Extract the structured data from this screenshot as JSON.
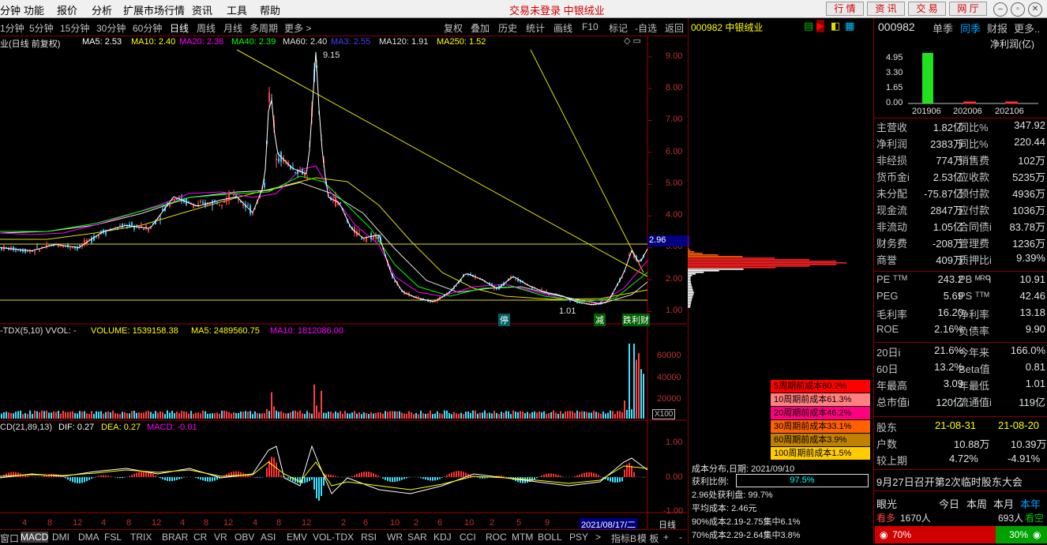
{
  "menu": {
    "items": [
      "分钟",
      "功能",
      "报价",
      "分析",
      "扩展市场行情",
      "资讯",
      "工具",
      "帮助"
    ],
    "center_msg": "交易未登录  中银绒业",
    "trade_buttons": [
      "行 情",
      "资 讯",
      "交 易",
      "网 厅"
    ]
  },
  "toolbar": {
    "periods": [
      "1分钟",
      "5分钟",
      "15分钟",
      "30分钟",
      "60分钟",
      "日线",
      "周线",
      "月线",
      "多周期",
      "更多 >"
    ],
    "active_period": "日线",
    "buttons": [
      "复权",
      "叠加",
      "历史",
      "统计",
      "画线",
      "F10",
      "标记",
      "-自选",
      "返回"
    ]
  },
  "main_chart": {
    "title": "业(日线 前复权)",
    "ma_labels": [
      {
        "text": "MA5: 2.53",
        "color": "#ffffff"
      },
      {
        "text": "MA10: 2.40",
        "color": "#ffff00"
      },
      {
        "text": "MA20: 2.36",
        "color": "#ff00ff"
      },
      {
        "text": "MA40: 2.39",
        "color": "#00ff00"
      },
      {
        "text": "MA60: 2.40",
        "color": "#e0e0e0"
      },
      {
        "text": "MA3: 2.55",
        "color": "#4040ff"
      },
      {
        "text": "MA120: 1.91",
        "color": "#e0e0e0"
      },
      {
        "text": "MA250: 1.52",
        "color": "#ffff00"
      }
    ],
    "y_ticks": [
      "9.00",
      "8.00",
      "7.00",
      "6.00",
      "5.00",
      "4.00",
      "3.00",
      "2.00",
      "1.00"
    ],
    "high_label": "9.15",
    "low_label": "1.01",
    "current_price_tag": "2.96",
    "markers": [
      "停",
      "减",
      "跌",
      "利",
      "财"
    ]
  },
  "volume_chart": {
    "title": "-TDX(5,10)  VVOL: -",
    "volume_label": "VOLUME: 1539158.38",
    "ma5_label": "MA5: 2489560.75",
    "ma10_label": "MA10: 1812086.00",
    "y_ticks": [
      "60000",
      "40000",
      "20000"
    ],
    "unit": "X100"
  },
  "macd_chart": {
    "title": "CD(21,89,13)",
    "dif": "DIF: 0.27",
    "dea": "DEA: 0.27",
    "macd": "MACD: -0.01",
    "y_ticks": [
      "1.00",
      "0.00",
      "-1.00"
    ]
  },
  "x_axis": {
    "labels": [
      "4",
      "8",
      "12",
      "4",
      "8",
      "12",
      "4",
      "8",
      "12",
      "4",
      "8",
      "12",
      "2",
      "6",
      "10",
      "2",
      "6",
      "10",
      "2",
      "5",
      "9"
    ],
    "cursor_date": "2021/08/17/二",
    "end_label": "日线"
  },
  "bottom_tabs": [
    "窗口",
    "MACD",
    "DMI",
    "DMA",
    "FSL",
    "TRIX",
    "BRAR",
    "CR",
    "VR",
    "OBV",
    "ASI",
    "EMV",
    "VOL-TDX",
    "RSI",
    "WR",
    "SAR",
    "KDJ",
    "CCI",
    "ROC",
    "MTM",
    "BOLL",
    "PSY",
    ">",
    "指标B",
    "模 板",
    "+",
    "-"
  ],
  "cost_panel": {
    "header": "000982 中银绒业",
    "legend": [
      {
        "text": "5周期前成本80.2%",
        "color": "#ff0000"
      },
      {
        "text": "10周期前成本61.3%",
        "color": "#ff8080"
      },
      {
        "text": "20周期前成本46.2%",
        "color": "#ff0080"
      },
      {
        "text": "30周期前成本33.1%",
        "color": "#ff6000"
      },
      {
        "text": "60周期前成本3.9%",
        "color": "#c08000"
      },
      {
        "text": "100周期前成本1.5%",
        "color": "#ffcc00"
      }
    ],
    "date_line": "成本分布,日期:  2021/09/10",
    "profit_ratio_label": "获利比例:",
    "profit_ratio_value": "97.5%",
    "profit_ratio": 0.975,
    "lines": [
      "2.96处获利盘:  99.7%",
      "平均成本:  2.46元",
      "90%成本2.19-2.75集中6.1%",
      "70%成本2.29-2.64集中3.8%"
    ]
  },
  "fin_panel": {
    "code": "000982",
    "tabs": [
      "单季",
      "同季",
      "财报",
      "更多.."
    ],
    "chart_title": "净利润(亿)",
    "y_ticks": [
      "4.95",
      "3.30",
      "1.65",
      "0.00"
    ],
    "bars": [
      {
        "label": "201906",
        "value": 5.6
      },
      {
        "label": "202006",
        "value": 0.2
      },
      {
        "label": "202106",
        "value": 0.2
      }
    ],
    "rows": [
      [
        "主营收",
        "1.82亿",
        "同比%",
        "347.92"
      ],
      [
        "净利润",
        "2383万",
        "同比%",
        "220.44"
      ],
      [
        "非经损",
        "774万",
        "销售费",
        "102万"
      ],
      [
        "货币金i",
        "2.53亿",
        "应收款",
        "5235万"
      ],
      [
        "未分配",
        "-75.87亿",
        "预付款",
        "4936万"
      ],
      [
        "现金流",
        "2847万",
        "应付款",
        "1036万"
      ],
      [
        "非流动",
        "1.05亿",
        "合同债i",
        "83.78万"
      ],
      [
        "财务费",
        "-208万",
        "管理费",
        "1236万"
      ],
      [
        "商誉",
        "409万",
        "质押比i",
        "9.39%"
      ]
    ],
    "rows2": [
      [
        "PE ᵀᵀᴹ",
        "243.2",
        "PB ᴹᴿᑫ",
        "10.91"
      ],
      [
        "PEG",
        "5.69",
        "PS ᵀᵀᴹ",
        "42.46"
      ],
      [
        "毛利率",
        "16.20",
        "净利率",
        "13.18"
      ],
      [
        "ROE",
        "2.16%",
        "负债率",
        "9.90"
      ]
    ],
    "rows3": [
      [
        "20日i",
        "21.6%",
        "今年来",
        "166.0%"
      ],
      [
        "60日",
        "13.2%",
        "Beta值",
        "0.81"
      ],
      [
        "年最高",
        "3.09",
        "年最低",
        "1.01"
      ],
      [
        "总市值i",
        "120亿",
        "流通值i",
        "119亿"
      ]
    ],
    "shareholders": {
      "label": "股东",
      "d1": "21-08-31",
      "d2": "21-08-20",
      "rows": [
        [
          "户数",
          "10.88万",
          "10.39万"
        ],
        [
          "较上期",
          "4.72%",
          "-4.91%"
        ]
      ]
    },
    "news": "9月27日召开第2次临时股东大会",
    "sentiment": {
      "label": "眼光",
      "tabs": [
        "今日",
        "本周",
        "本月",
        "本年"
      ],
      "bull_label": "看多",
      "bull_count": "1670人",
      "bear_count": "693人",
      "bear_label": "看空",
      "bull_pct": "70%",
      "bear_pct": "30%",
      "bull_ratio": 0.7
    }
  }
}
